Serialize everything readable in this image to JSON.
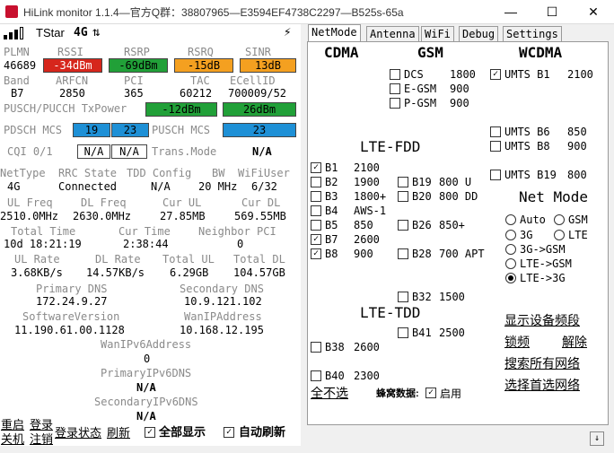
{
  "window": {
    "title": "HiLink monitor 1.1.4—官方Q群：38807965—E3594EF4738C2297—B525s-65a",
    "minimize": "—",
    "maximize": "☐",
    "close": "✕"
  },
  "status": {
    "carrier": "TStar",
    "net": "4G",
    "arrows": "⇅",
    "bolt": "⚡"
  },
  "signal": {
    "labels": {
      "plmn": "PLMN",
      "rssi": "RSSI",
      "rsrp": "RSRP",
      "rsrq": "RSRQ",
      "sinr": "SINR"
    },
    "plmn": "46689",
    "rssi": "-34dBm",
    "rsrp": "-69dBm",
    "rsrq": "-15dB",
    "sinr": "13dB"
  },
  "cell": {
    "labels": {
      "band": "Band",
      "arfcn": "ARFCN",
      "pci": "PCI",
      "tac": "TAC",
      "ecellid": "ECellID"
    },
    "band": "B7",
    "arfcn": "2850",
    "pci": "365",
    "tac": "60212",
    "ecellid": "700009/52"
  },
  "txpower": {
    "label": "PUSCH/PUCCH TxPower",
    "v1": "-12dBm",
    "v2": "26dBm"
  },
  "mcs": {
    "pdsch_label": "PDSCH MCS",
    "pdsch1": "19",
    "pdsch2": "23",
    "pusch_label": "PUSCH MCS",
    "pusch": "23"
  },
  "cqi": {
    "label": "CQI 0/1",
    "v1": "N/A",
    "v2": "N/A",
    "tm_label": "Trans.Mode",
    "tm": "N/A"
  },
  "rowA": {
    "labels": [
      "NetType",
      "RRC State",
      "TDD Config",
      "BW",
      "WiFiUser"
    ],
    "values": [
      "4G",
      "Connected",
      "N/A",
      "20 MHz",
      "6/32"
    ]
  },
  "rowB": {
    "labels": [
      "UL Freq",
      "DL Freq",
      "Cur UL",
      "Cur DL"
    ],
    "values": [
      "2510.0MHz",
      "2630.0MHz",
      "27.85MB",
      "569.55MB"
    ]
  },
  "rowC": {
    "labels": [
      "Total Time",
      "Cur Time",
      "Neighbor PCI"
    ],
    "values": [
      "10d 18:21:19",
      "2:38:44",
      "0"
    ]
  },
  "rowD": {
    "labels": [
      "UL Rate",
      "DL Rate",
      "Total UL",
      "Total DL"
    ],
    "values": [
      "3.68KB/s",
      "14.57KB/s",
      "6.29GB",
      "104.57GB"
    ]
  },
  "dns": {
    "pri_label": "Primary DNS",
    "pri": "172.24.9.27",
    "sec_label": "Secondary DNS",
    "sec": "10.9.121.102"
  },
  "ver": {
    "sw_label": "SoftwareVersion",
    "sw": "11.190.61.00.1128",
    "wan_label": "WanIPAddress",
    "wan": "10.168.12.195"
  },
  "ipv6": {
    "wan_label": "WanIPv6Address",
    "wan": "0",
    "pri_label": "PrimaryIPv6DNS",
    "pri": "N/A",
    "sec_label": "SecondaryIPv6DNS",
    "sec": "N/A"
  },
  "bottom": {
    "restart": "重启",
    "shutdown": "关机",
    "login": "登录",
    "logout": "注销",
    "login_status": "登录状态",
    "refresh": "刷新",
    "show_all": "全部显示",
    "auto_refresh": "自动刷新"
  },
  "tabs": [
    "NetMode",
    "Antenna",
    "WiFi",
    "Debug",
    "Settings"
  ],
  "netmode": {
    "cdma": "CDMA",
    "gsm": "GSM",
    "wcdma": "WCDMA",
    "gsm_bands": [
      {
        "name": "DCS",
        "freq": "1800"
      },
      {
        "name": "E-GSM",
        "freq": "900"
      },
      {
        "name": "P-GSM",
        "freq": "900"
      }
    ],
    "wcdma_bands": [
      {
        "name": "UMTS B1",
        "freq": "2100",
        "checked": true
      },
      {
        "name": "UMTS B6",
        "freq": "850"
      },
      {
        "name": "UMTS B8",
        "freq": "900"
      },
      {
        "name": "UMTS B19",
        "freq": "800"
      }
    ],
    "lte_fdd": "LTE-FDD",
    "fdd_left": [
      {
        "name": "B1",
        "freq": "2100",
        "checked": true
      },
      {
        "name": "B2",
        "freq": "1900"
      },
      {
        "name": "B3",
        "freq": "1800+"
      },
      {
        "name": "B4",
        "freq": "AWS-1"
      },
      {
        "name": "B5",
        "freq": "850"
      },
      {
        "name": "B7",
        "freq": "2600",
        "checked": true
      },
      {
        "name": "B8",
        "freq": "900",
        "checked": true
      }
    ],
    "fdd_right": [
      {
        "name": "B19",
        "freq": "800 U"
      },
      {
        "name": "B20",
        "freq": "800 DD"
      },
      {
        "name": "B26",
        "freq": "850+"
      },
      {
        "name": "B28",
        "freq": "700 APT"
      },
      {
        "name": "B32",
        "freq": "1500"
      }
    ],
    "lte_tdd": "LTE-TDD",
    "tdd": [
      {
        "name": "B41",
        "freq": "2500"
      },
      {
        "name": "B38",
        "freq": "2600"
      },
      {
        "name": "B40",
        "freq": "2300"
      }
    ],
    "net_mode_title": "Net Mode",
    "modes": [
      "Auto",
      "GSM",
      "3G",
      "LTE",
      "3G->GSM",
      "LTE->GSM",
      "LTE->3G"
    ],
    "links": {
      "show_bands": "显示设备频段",
      "lock": "锁频",
      "unlock": "解除",
      "search": "搜索所有网络",
      "select": "选择首选网络"
    },
    "uncheck_all": "全不选",
    "cellular_label": "蜂窝数据:",
    "enable": "启用"
  },
  "scroll_arrow": "↓",
  "colors": {
    "red": "#d6261c",
    "green": "#21a038",
    "orange": "#f4a020",
    "blue": "#1e90d6"
  }
}
